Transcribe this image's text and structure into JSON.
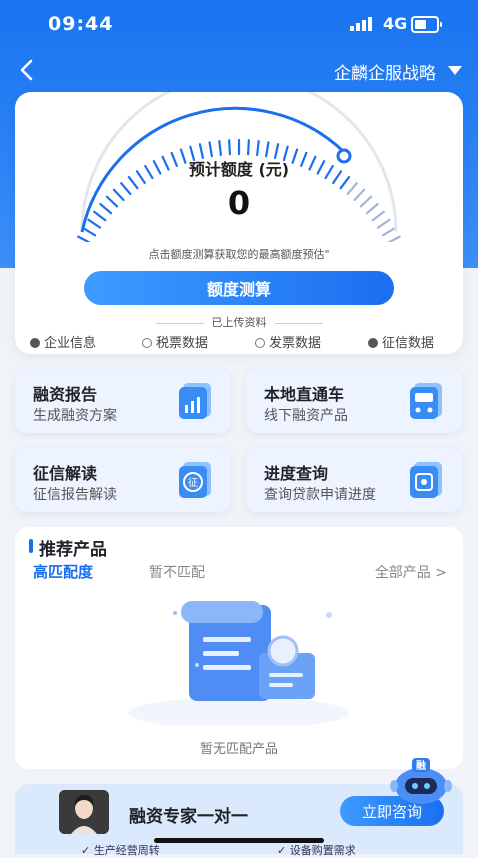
{
  "status": {
    "time": "09:44",
    "network": "4G"
  },
  "nav": {
    "enterprise": "企麟企服战略"
  },
  "quota": {
    "title": "预计额度 (元)",
    "value": "0",
    "hint": "点击额度测算获取您的最高额度预估\"",
    "button": "额度测算",
    "uploaded": "已上传资料",
    "checks": [
      {
        "label": "企业信息",
        "checked": true
      },
      {
        "label": "税票数据",
        "checked": false
      },
      {
        "label": "发票数据",
        "checked": false
      },
      {
        "label": "征信数据",
        "checked": true
      }
    ]
  },
  "tiles": [
    {
      "title": "融资报告",
      "sub": "生成融资方案",
      "icon": "report-chart-icon"
    },
    {
      "title": "本地直通车",
      "sub": "线下融资产品",
      "icon": "bus-icon"
    },
    {
      "title": "征信解读",
      "sub": "征信报告解读",
      "icon": "credit-doc-icon"
    },
    {
      "title": "进度查询",
      "sub": "查询贷款申请进度",
      "icon": "progress-search-icon"
    }
  ],
  "recommend": {
    "title": "推荐产品",
    "tab_high": "高匹配度",
    "tab_none": "暂不匹配",
    "all": "全部产品 >",
    "empty": "暂无匹配产品"
  },
  "expert": {
    "label": "融资专家一对一",
    "button": "立即咨询",
    "robot": "融",
    "bottom_left": "✓ 生产经营周转",
    "bottom_right": "✓ 设备购置需求"
  },
  "colors": {
    "primary": "#1a6ff0",
    "header": "#2f86f6"
  }
}
